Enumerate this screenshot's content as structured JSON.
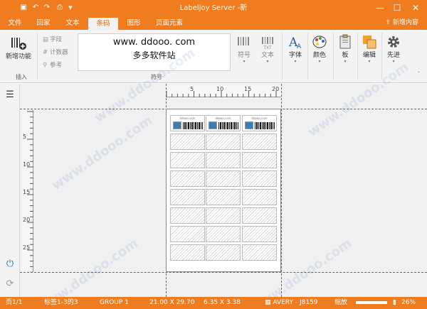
{
  "window": {
    "title": "Labeljoy Server -新",
    "minimize": "—",
    "maximize": "☐",
    "close": "✕"
  },
  "tabs": [
    "文件",
    "回家",
    "文本",
    "条码",
    "图形",
    "页面元素"
  ],
  "active_tab": "条码",
  "tab_right": "新增内容",
  "ribbon": {
    "add_function": "新增功能",
    "group_insert": "插入",
    "field": "字段",
    "counter": "计数器",
    "reference": "参考",
    "preview_line1": "www. ddooo. com",
    "preview_line2": "多多软件站",
    "symbol": "符号",
    "text": "文本",
    "group_symbol": "符号",
    "font": "字体",
    "color": "颜色",
    "board": "板",
    "edit": "编辑",
    "advanced": "先进"
  },
  "ruler_h": [
    "5",
    "10",
    "15",
    "20"
  ],
  "ruler_v": [
    "5",
    "10",
    "15",
    "20",
    "25"
  ],
  "label_header": "ddooo.com",
  "watermark": "www.ddooo.com",
  "status": {
    "page": "页1/1",
    "labels": "标签1-3的3",
    "group": "GROUP 1",
    "page_size": "21.00 X 29.70",
    "label_size": "6.35 X 3.38",
    "template": "AVERY - J8159",
    "zoom_label": "缩放",
    "zoom": "26%"
  },
  "colors": {
    "accent": "#f07c20",
    "ribbon": "#f3f3f3"
  }
}
